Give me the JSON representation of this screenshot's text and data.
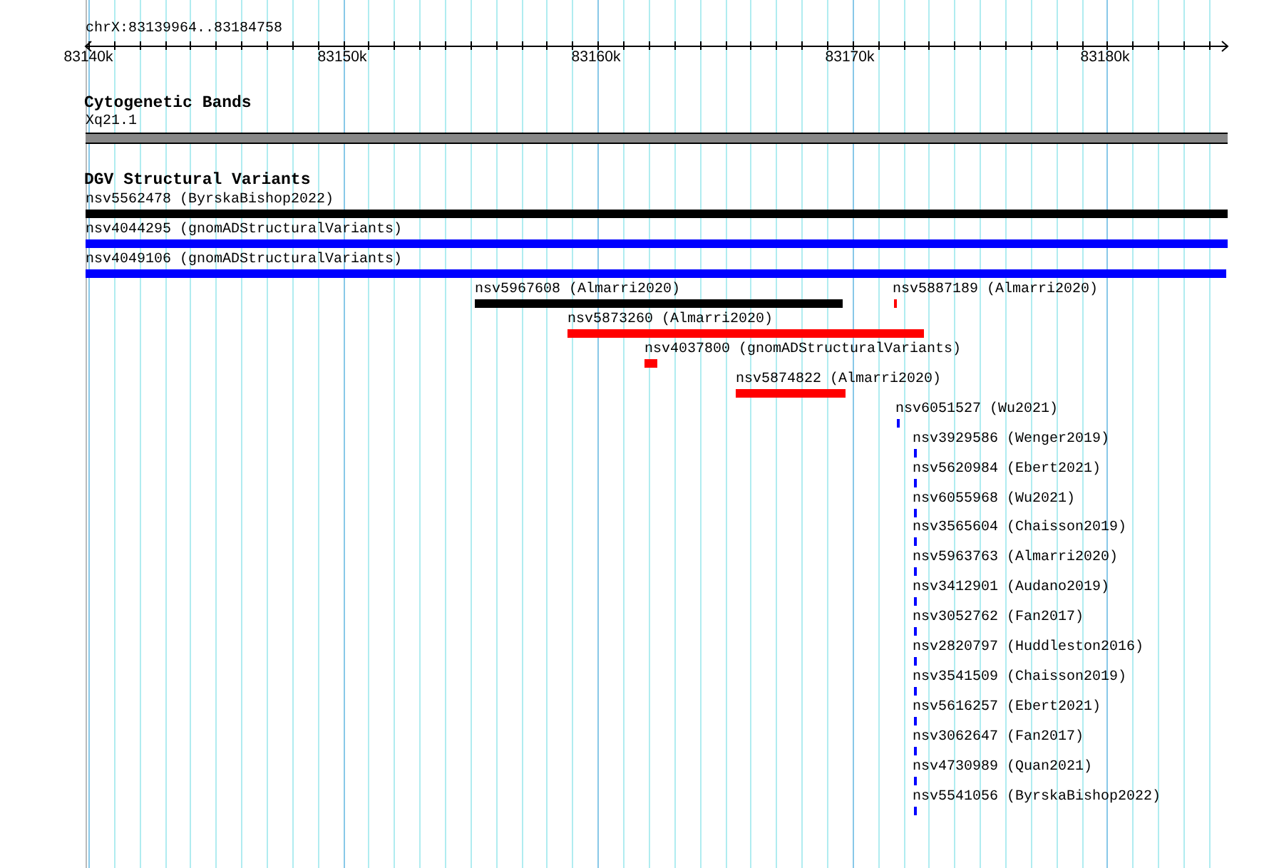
{
  "location": "chrX:83139964..83184758",
  "ruler": {
    "ticks": [
      "83140k",
      "83150k",
      "83160k",
      "83170k",
      "83180k"
    ]
  },
  "tracks": [
    {
      "title": "Cytogenetic Bands",
      "features": [
        {
          "label": "Xq21.1",
          "color": "#888888"
        }
      ]
    },
    {
      "title": "DGV Structural Variants",
      "features": [
        {
          "label": "nsv5562478 (ByrskaBishop2022)",
          "color": "#000000"
        },
        {
          "label": "nsv4044295 (gnomADStructuralVariants)",
          "color": "#0000ff"
        },
        {
          "label": "nsv4049106 (gnomADStructuralVariants)",
          "color": "#0000ff"
        },
        {
          "label": "nsv5967608 (Almarri2020)",
          "color": "#000000"
        },
        {
          "label": "nsv5887189 (Almarri2020)",
          "color": "#ff0000"
        },
        {
          "label": "nsv5873260 (Almarri2020)",
          "color": "#ff0000"
        },
        {
          "label": "nsv4037800 (gnomADStructuralVariants)",
          "color": "#ff0000"
        },
        {
          "label": "nsv5874822 (Almarri2020)",
          "color": "#ff0000"
        },
        {
          "label": "nsv6051527 (Wu2021)",
          "color": "#0000ff"
        },
        {
          "label": "nsv3929586 (Wenger2019)",
          "color": "#0000ff"
        },
        {
          "label": "nsv5620984 (Ebert2021)",
          "color": "#0000ff"
        },
        {
          "label": "nsv6055968 (Wu2021)",
          "color": "#0000ff"
        },
        {
          "label": "nsv3565604 (Chaisson2019)",
          "color": "#0000ff"
        },
        {
          "label": "nsv5963763 (Almarri2020)",
          "color": "#0000ff"
        },
        {
          "label": "nsv3412901 (Audano2019)",
          "color": "#0000ff"
        },
        {
          "label": "nsv3052762 (Fan2017)",
          "color": "#0000ff"
        },
        {
          "label": "nsv2820797 (Huddleston2016)",
          "color": "#0000ff"
        },
        {
          "label": "nsv3541509 (Chaisson2019)",
          "color": "#0000ff"
        },
        {
          "label": "nsv5616257 (Ebert2021)",
          "color": "#0000ff"
        },
        {
          "label": "nsv3062647 (Fan2017)",
          "color": "#0000ff"
        },
        {
          "label": "nsv4730989 (Quan2021)",
          "color": "#0000ff"
        },
        {
          "label": "nsv5541056 (ByrskaBishop2022)",
          "color": "#0000ff"
        }
      ]
    }
  ]
}
